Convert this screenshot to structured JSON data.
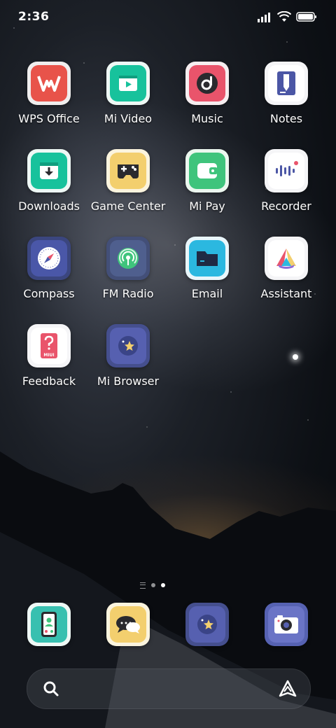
{
  "status_bar": {
    "time": "2:36"
  },
  "apps": [
    {
      "label": "WPS Office",
      "icon": "wps-office-icon"
    },
    {
      "label": "Mi Video",
      "icon": "mi-video-icon"
    },
    {
      "label": "Music",
      "icon": "music-icon"
    },
    {
      "label": "Notes",
      "icon": "notes-icon"
    },
    {
      "label": "Downloads",
      "icon": "downloads-icon"
    },
    {
      "label": "Game Center",
      "icon": "game-center-icon"
    },
    {
      "label": "Mi Pay",
      "icon": "mi-pay-icon"
    },
    {
      "label": "Recorder",
      "icon": "recorder-icon"
    },
    {
      "label": "Compass",
      "icon": "compass-icon"
    },
    {
      "label": "FM Radio",
      "icon": "fm-radio-icon"
    },
    {
      "label": "Email",
      "icon": "email-icon"
    },
    {
      "label": "Assistant",
      "icon": "assistant-icon"
    },
    {
      "label": "Feedback",
      "icon": "feedback-icon"
    },
    {
      "label": "Mi Browser",
      "icon": "mi-browser-icon"
    }
  ],
  "icon_text": {
    "feedback_badge": "MIUI"
  },
  "dock": [
    {
      "icon": "contacts-icon"
    },
    {
      "icon": "messaging-icon"
    },
    {
      "icon": "browser-icon"
    },
    {
      "icon": "camera-icon"
    }
  ],
  "page_indicator": {
    "pages": 2,
    "active": 2
  },
  "colors": {
    "wps": "#e8534a",
    "mi_video": "#17c29c",
    "music": "#e9546b",
    "notes": "#4b56a5",
    "game_center": "#f3cf6e",
    "mi_pay": "#3fc47c",
    "compass": "#4a57a8",
    "fm_radio": "#4f5f8e",
    "email": "#2bb8e0",
    "browser": "#5660b0"
  }
}
